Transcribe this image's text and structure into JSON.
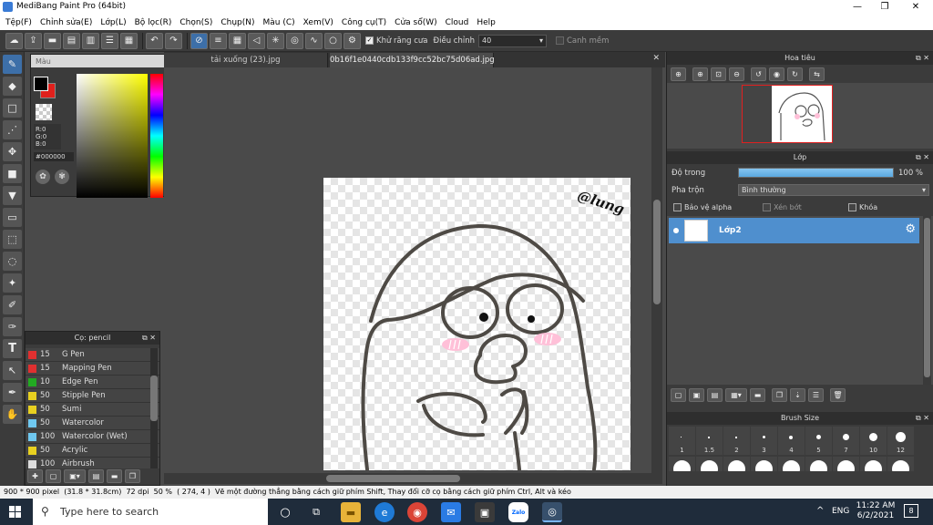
{
  "app": {
    "title": "MediBang Paint Pro (64bit)"
  },
  "window_buttons": {
    "minimize": "—",
    "maximize": "❐",
    "close": "✕"
  },
  "menu": [
    "Tệp(F)",
    "Chỉnh sửa(E)",
    "Lớp(L)",
    "Bộ lọc(R)",
    "Chọn(S)",
    "Chụp(N)",
    "Màu (C)",
    "Xem(V)",
    "Công cụ(T)",
    "Cửa sổ(W)",
    "Cloud",
    "Help"
  ],
  "toolbar": {
    "antialias_label": "Khử răng cưa",
    "correction_label": "Điều chỉnh",
    "correction_value": "40",
    "snap_label": "Canh mềm"
  },
  "color_panel": {
    "title": "Màu",
    "r": "R:0",
    "g": "G:0",
    "b": "B:0",
    "hex": "#000000",
    "foreground": "#000000",
    "background": "#e0201c"
  },
  "brush_panel": {
    "title": "Cọ: pencil",
    "items": [
      {
        "size": "15",
        "name": "G Pen",
        "color": "#e03030"
      },
      {
        "size": "15",
        "name": "Mapping Pen",
        "color": "#e03030"
      },
      {
        "size": "10",
        "name": "Edge Pen",
        "color": "#22aa22"
      },
      {
        "size": "50",
        "name": "Stipple Pen",
        "color": "#e8d020"
      },
      {
        "size": "50",
        "name": "Sumi",
        "color": "#e8d020"
      },
      {
        "size": "50",
        "name": "Watercolor",
        "color": "#6fc8f0"
      },
      {
        "size": "100",
        "name": "Watercolor (Wet)",
        "color": "#6fc8f0"
      },
      {
        "size": "50",
        "name": "Acrylic",
        "color": "#e8d020"
      },
      {
        "size": "100",
        "name": "Airbrush",
        "color": "#dddddd"
      }
    ]
  },
  "tabs": [
    {
      "label": "tải xuống (23).jpg",
      "active": false
    },
    {
      "label": "0b16f1e0440cdb133f9cc52bc75d06ad.jpg",
      "active": true
    }
  ],
  "canvas": {
    "signature": "@lung"
  },
  "navigator": {
    "title": "Hoa tiêu"
  },
  "layer_panel": {
    "title": "Lớp",
    "opacity_label": "Độ trong",
    "opacity_value": "100 %",
    "opacity": 1.0,
    "blend_label": "Pha trộn",
    "blend_value": "Bình thường",
    "protect_alpha": "Bảo vệ alpha",
    "clipping": "Xén bớt",
    "lock": "Khóa",
    "layer_name": "Lớp2"
  },
  "brush_size": {
    "title": "Brush Size",
    "sizes": [
      "1",
      "1.5",
      "2",
      "3",
      "4",
      "5",
      "7",
      "10",
      "12"
    ]
  },
  "status": {
    "dims": "900 * 900 pixel",
    "cm": "(31.8 * 31.8cm)",
    "dpi": "72 dpi",
    "zoom": "50 %",
    "coords": "( 274, 4 )",
    "hint": "Vẽ một đường thẳng bằng cách giữ phím Shift, Thay đổi cỡ cọ bằng cách giữ phím Ctrl, Alt và kéo"
  },
  "taskbar": {
    "search_placeholder": "Type here to search",
    "lang": "ENG",
    "time": "11:22 AM",
    "date": "6/2/2021",
    "notifications": "8"
  }
}
